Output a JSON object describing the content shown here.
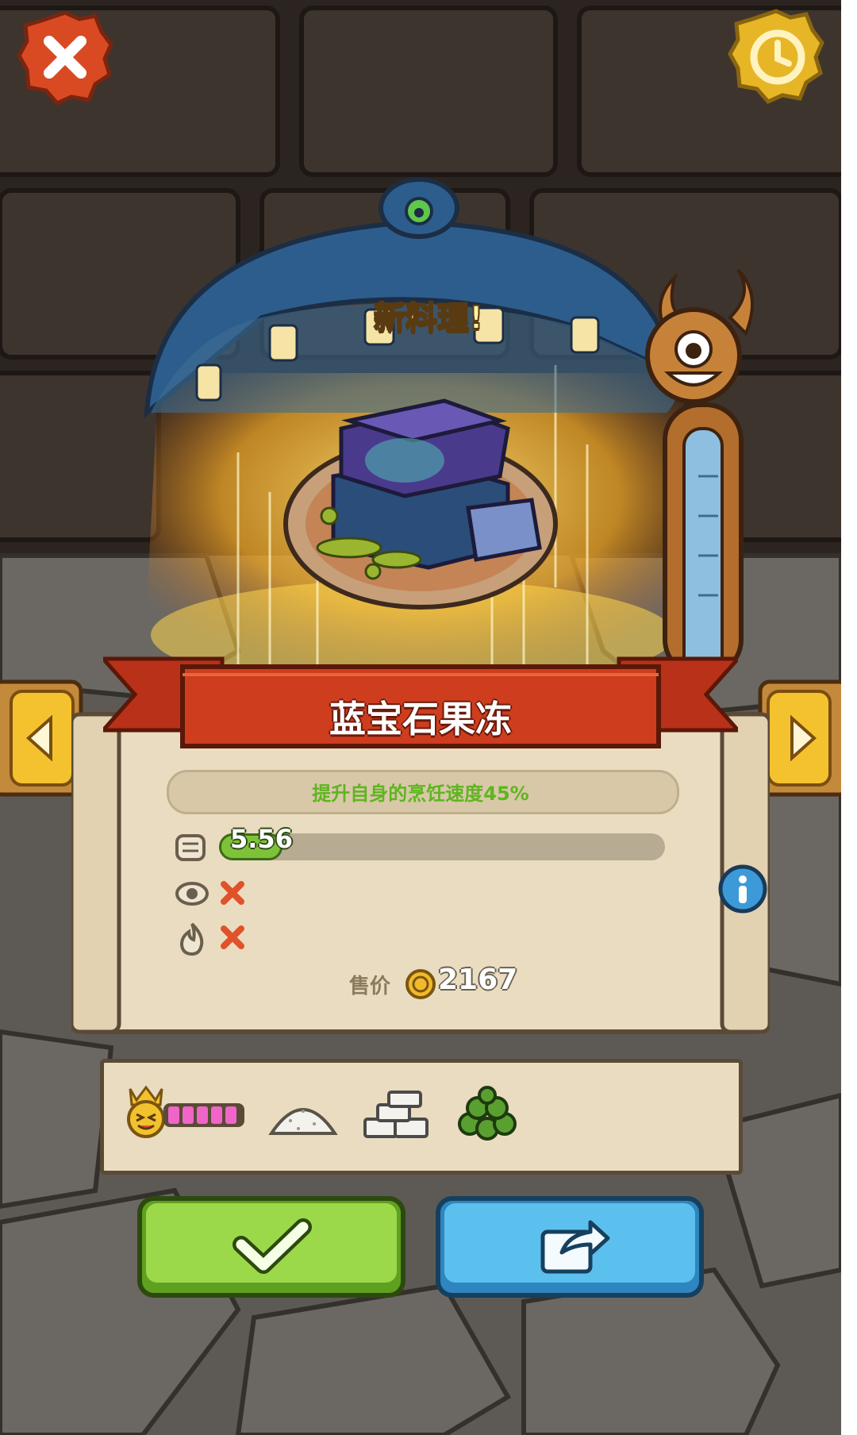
{
  "header": {
    "close_icon": "close-icon",
    "history_icon": "history-clock-icon"
  },
  "reveal": {
    "new_dish_label": "新料理!",
    "dish_image": "sapphire-jelly-dish"
  },
  "dish": {
    "name": "蓝宝石果冻",
    "effect": "提升自身的烹饪速度45%",
    "progress_value": "5.56",
    "progress_fraction": 0.1,
    "stat_icons": [
      "timer-icon",
      "eye-icon",
      "flame-icon"
    ],
    "stat_flags": [
      "cross-icon",
      "cross-icon"
    ],
    "price_label": "售价",
    "price_value": "2167",
    "price_icon": "coin-icon"
  },
  "ingredients": {
    "rank_icon": "crowned-face-icon",
    "rank_level": 5,
    "items": [
      "salt-pile",
      "sugar-cubes",
      "green-peas"
    ]
  },
  "actions": {
    "confirm_icon": "checkmark-icon",
    "share_icon": "share-icon"
  },
  "colors": {
    "brick": "#3a302b",
    "stone": "#55534f",
    "parchment": "#eadcc0",
    "banner": "#c2381c",
    "confirm": "#8fd33a",
    "share": "#4fb4e8"
  }
}
